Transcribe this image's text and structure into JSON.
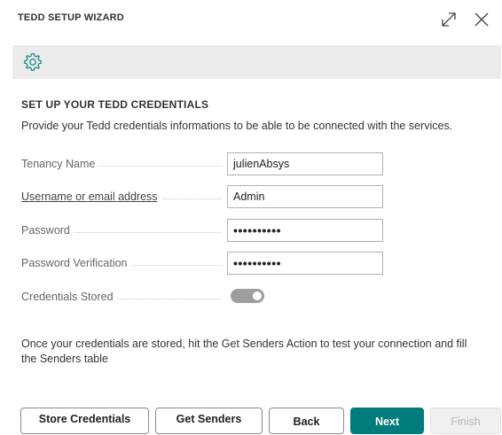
{
  "window": {
    "title": "TEDD SETUP WIZARD",
    "expand_icon": "expand-icon",
    "close_icon": "close-icon"
  },
  "toolbar": {
    "icon": "gear-icon"
  },
  "section": {
    "title": "SET UP YOUR TEDD CREDENTIALS",
    "description": "Provide your Tedd credentials informations to be able to be connected with the services."
  },
  "fields": [
    {
      "label": "Tenancy Name",
      "value": "julienAbsys"
    },
    {
      "label": "Username or email address",
      "value": "Admin"
    },
    {
      "label": "Password",
      "value": "••••••••••"
    },
    {
      "label": "Password Verification",
      "value": "••••••••••"
    },
    {
      "label": "Credentials Stored",
      "value": true
    }
  ],
  "note": "Once your credentials are stored, hit the Get Senders Action to test your connection and fill the Senders table",
  "buttons": {
    "store": "Store Credentials",
    "get_senders": "Get Senders",
    "back": "Back",
    "next": "Next",
    "finish": "Finish"
  },
  "colors": {
    "primary": "#007c7c",
    "toggle_on": "#9e9e9e",
    "toolbar_bg": "#ebebeb"
  }
}
